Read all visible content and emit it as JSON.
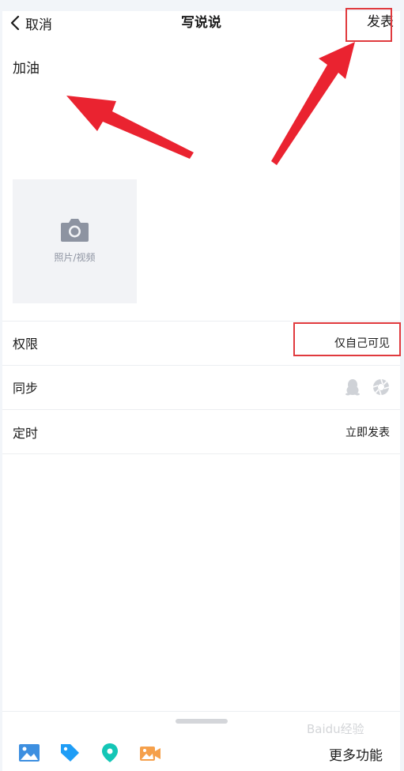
{
  "header": {
    "cancel_label": "取消",
    "title": "写说说",
    "publish_label": "发表"
  },
  "composer": {
    "text": "加油"
  },
  "media": {
    "label": "照片/视频"
  },
  "settings": [
    {
      "label": "权限",
      "value": "仅自己可见"
    },
    {
      "label": "同步",
      "value": ""
    },
    {
      "label": "定时",
      "value": "立即发表"
    }
  ],
  "bottom": {
    "tools": [
      "image-icon",
      "tag-icon",
      "location-icon",
      "video-icon"
    ],
    "more_label": "更多功能"
  },
  "watermark_text": "Baidu经验",
  "colors": {
    "accent_red": "#e03a3e",
    "tag_blue": "#1f9df6",
    "location_teal": "#14c6b6",
    "video_orange": "#f5a04b",
    "image_blue": "#3d8fe0"
  }
}
